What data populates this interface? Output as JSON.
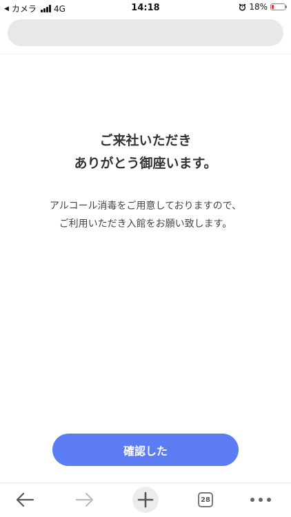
{
  "status_bar": {
    "back_app_label": "カメラ",
    "network": "4G",
    "time": "14:18",
    "battery_percent_text": "18%",
    "battery_level": 0.18
  },
  "address_bar": {
    "text": ""
  },
  "content": {
    "heading_line1": "ご来社いただき",
    "heading_line2": "ありがとう御座います。",
    "body_line1": "アルコール消毒をご用意しておりますので、",
    "body_line2": "ご利用いただき入館をお願い致します。"
  },
  "confirm_button": {
    "label": "確認した",
    "color": "#5b7cf3"
  },
  "toolbar": {
    "tab_count": "28",
    "icons": [
      "back-arrow-icon",
      "forward-arrow-icon",
      "new-tab-plus-icon",
      "tabs-icon",
      "more-icon"
    ]
  }
}
